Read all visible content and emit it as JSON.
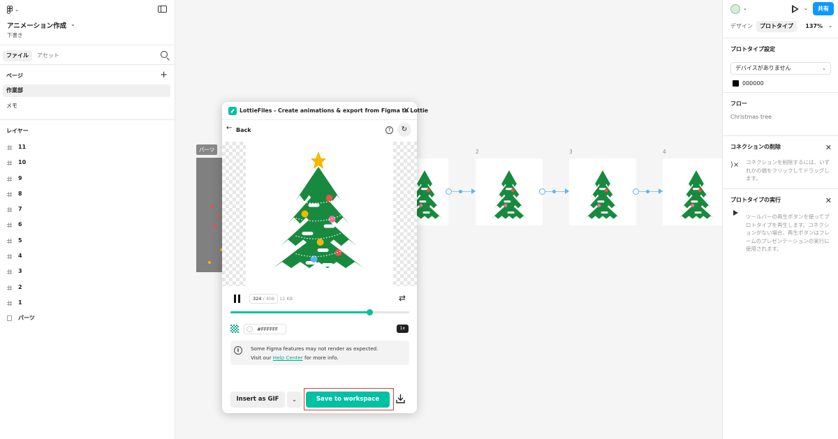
{
  "left_panel": {
    "file_title": "アニメーション作成",
    "file_subtitle": "下書き",
    "tabs": [
      "ファイル",
      "アセット"
    ],
    "pages_header": "ページ",
    "pages": [
      {
        "label": "作業部",
        "selected": true
      },
      {
        "label": "メモ",
        "selected": false
      }
    ],
    "layers_header": "レイヤー",
    "layers": [
      {
        "label": "11",
        "type": "frame"
      },
      {
        "label": "10",
        "type": "frame"
      },
      {
        "label": "9",
        "type": "frame"
      },
      {
        "label": "8",
        "type": "frame"
      },
      {
        "label": "7",
        "type": "frame"
      },
      {
        "label": "6",
        "type": "frame"
      },
      {
        "label": "5",
        "type": "frame"
      },
      {
        "label": "4",
        "type": "frame"
      },
      {
        "label": "3",
        "type": "frame"
      },
      {
        "label": "2",
        "type": "frame"
      },
      {
        "label": "1",
        "type": "frame"
      },
      {
        "label": "パーツ",
        "type": "component"
      }
    ]
  },
  "right_panel": {
    "share_label": "共有",
    "tabs": {
      "design": "デザイン",
      "prototype": "プロトタイプ"
    },
    "zoom": "137%",
    "proto_settings": {
      "header": "プロトタイプ設定",
      "device": "デバイスがありません",
      "bg_color": "000000"
    },
    "flow": {
      "header": "フロー",
      "name": "Christmas tree"
    },
    "connection": {
      "header": "コネクションの削除",
      "text": "コネクションを削除するには、いずれかの端をクリックしてドラッグします。"
    },
    "run": {
      "header": "プロトタイプの実行",
      "text": "ツールバーの再生ボタンを使ってプロトタイプを再生します。コネクションがない場合、再生ボタンはフレームのプレゼンテーションの実行に使用されます。"
    }
  },
  "canvas": {
    "parts_label": "パーツ",
    "frame_labels": [
      "2",
      "3",
      "4"
    ]
  },
  "plugin": {
    "title": "LottieFiles - Create animations & export from Figma to Lottie",
    "back_label": "Back",
    "frame_current": "324",
    "frame_total": "408",
    "file_size": "12 KB",
    "progress": 0.78,
    "bg_hex": "#FFFFFF",
    "speed": "1x",
    "notice_line1": "Some Figma features may not render as expected.",
    "notice_visit": "Visit our ",
    "notice_link": "Help Center",
    "notice_tail": " for more info.",
    "insert_gif_label": "Insert as GIF",
    "save_label": "Save to workspace"
  },
  "colors": {
    "accent": "#00c1a2",
    "share_blue": "#0d99ff",
    "tree_green": "#188a3f",
    "highlight_red": "#e3362f",
    "connector_blue": "#5fb2f0"
  },
  "icons": [
    "figma-logo-icon",
    "panel-toggle-icon",
    "search-icon",
    "plus-icon",
    "frame-icon",
    "component-icon",
    "play-icon",
    "close-icon",
    "back-arrow-icon",
    "help-icon",
    "refresh-icon",
    "pause-icon",
    "loop-icon",
    "checker-icon",
    "info-icon",
    "chevron-down-icon",
    "download-icon"
  ]
}
